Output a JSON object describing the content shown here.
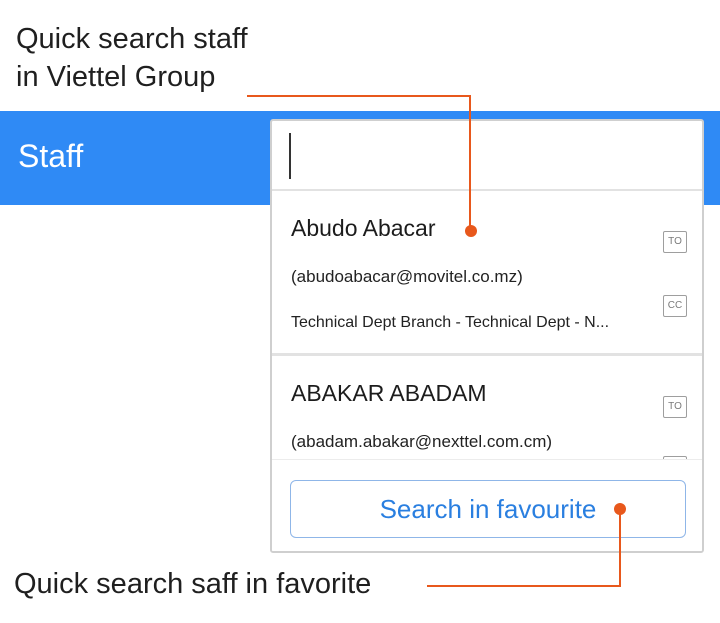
{
  "annotations": {
    "top": "Quick search staff\nin Viettel Group",
    "bottom": "Quick search saff in favorite"
  },
  "header": {
    "title": "Staff",
    "bar_color": "#2f8af5"
  },
  "search": {
    "value": "",
    "placeholder": ""
  },
  "results": [
    {
      "name": "Abudo Abacar",
      "email": "(abudoabacar@movitel.co.mz)",
      "department": "Technical Dept Branch - Technical Dept - N...",
      "to_label": "TO",
      "cc_label": "CC"
    },
    {
      "name": "ABAKAR ABADAM",
      "email": "(abadam.abakar@nexttel.com.cm)",
      "to_label": "TO"
    }
  ],
  "footer": {
    "button_label": "Search in favourite",
    "button_color": "#2a7fe0"
  },
  "accent_color": "#e8581c"
}
